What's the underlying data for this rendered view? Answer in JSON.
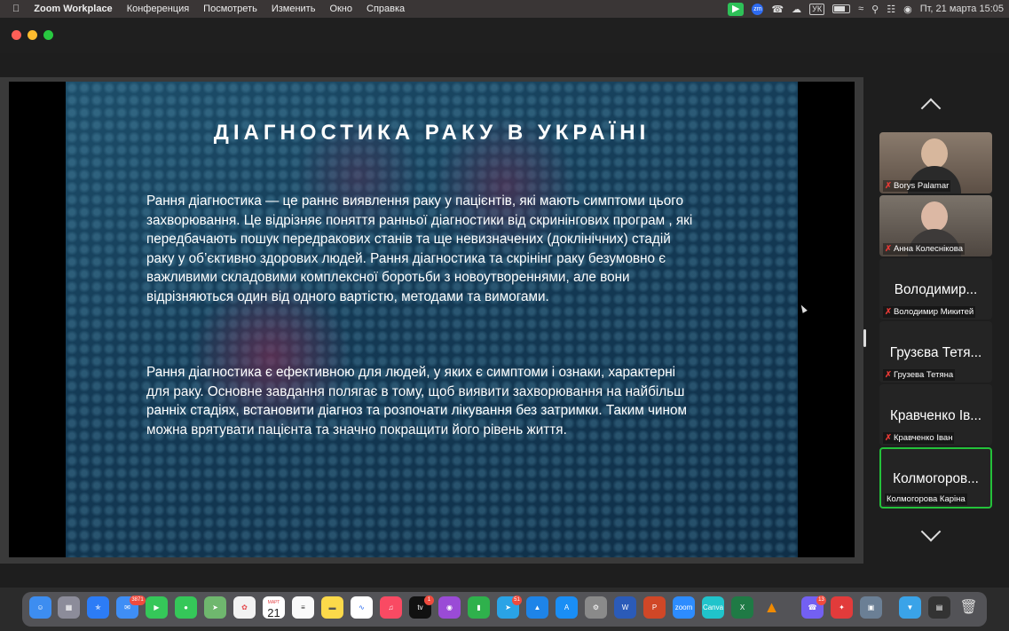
{
  "menubar": {
    "app_name": "Zoom Workplace",
    "items": [
      "Конференция",
      "Посмотреть",
      "Изменить",
      "Окно",
      "Справка"
    ],
    "keyboard_layout": "УК",
    "datetime": "Пт, 21 марта  15:05"
  },
  "slide": {
    "title": "ДІАГНОСТИКА РАКУ В УКРАЇНІ",
    "paragraph1": "Рання діагностика — це раннє виявлення раку у пацієнтів, які мають симптоми цього захворювання. Це відрізняє поняття ранньої діагностики від скринінгових програм , які передбачають пошук передракових станів та ще невизначених (доклінічних) стадій раку у об’єктивно здорових людей. Рання діагностика та скрінінг  раку безумовно є важливими складовими комплексної боротьби з новоутвореннями, але вони відрізняються один від одного вартістю, методами та вимогами.",
    "paragraph2": "Рання діагностика є ефективною для  людей, у яких є симптоми і ознаки, характерні для раку. Основне завдання  полягає в тому, щоб виявити захворювання на найбільш ранніх стадіях, встановити діагноз та розпочати лікування без затримки. Таким чином можна врятувати пацієнта та значно покращити його рівень життя."
  },
  "participants": [
    {
      "caption": "Borys Palamar",
      "display": "",
      "muted": true
    },
    {
      "caption": "Анна Колеснікова",
      "display": "",
      "muted": true
    },
    {
      "caption": "Володимир Микитей",
      "display": "Володимир...",
      "muted": true
    },
    {
      "caption": "Грузева Тетяна",
      "display": "Грузєва Тетя...",
      "muted": true
    },
    {
      "caption": "Кравченко Іван",
      "display": "Кравченко Ів...",
      "muted": true
    },
    {
      "caption": "Колмогорова Каріна",
      "display": "Колмогоров...",
      "muted": false,
      "active_speaker": true
    }
  ],
  "dock": {
    "calendar_month": "МАРТ",
    "calendar_day": "21",
    "mail_badge": "3871",
    "tv_badge": "1",
    "telegram_badge": "51",
    "viber_badge": "13"
  }
}
